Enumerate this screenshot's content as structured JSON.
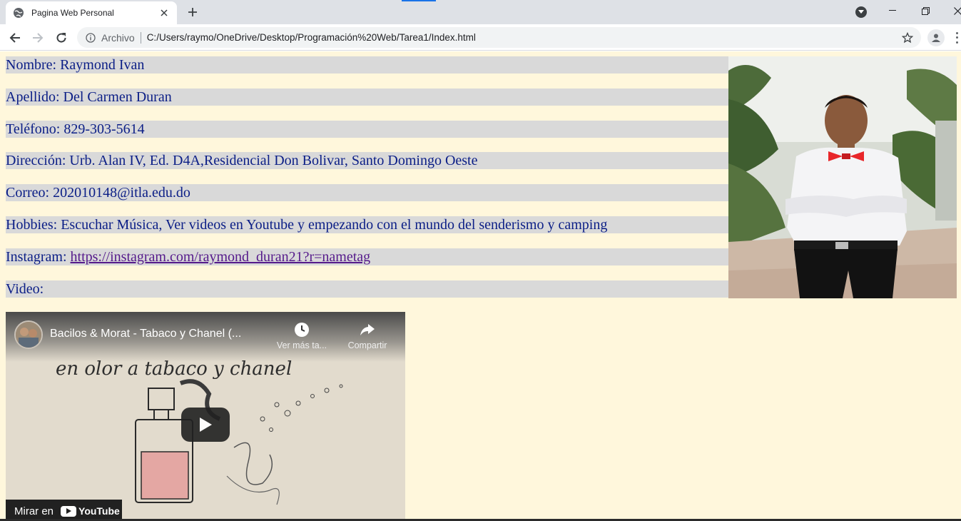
{
  "browser": {
    "tab_title": "Pagina Web Personal",
    "address_scheme_label": "Archivo",
    "url": "C:/Users/raymo/OneDrive/Desktop/Programación%20Web/Tarea1/Index.html"
  },
  "profile": {
    "nombre": "Nombre: Raymond Ivan",
    "apellido": "Apellido: Del Carmen Duran",
    "telefono": "Teléfono: 829-303-5614",
    "direccion": "Dirección: Urb. Alan IV, Ed. D4A,Residencial Don Bolivar, Santo Domingo Oeste",
    "correo": "Correo: 202010148@itla.edu.do",
    "hobbies": "Hobbies: Escuchar Música, Ver videos en Youtube y empezando con el mundo del senderismo y camping",
    "instagram_label": "Instagram: ",
    "instagram_link": "https://instagram.com/raymond_duran21?r=nametag",
    "video_label": "Video:"
  },
  "video": {
    "title": "Bacilos & Morat - Tabaco y Chanel (...",
    "watch_later": "Ver más ta...",
    "share": "Compartir",
    "watch_on": "Mirar en",
    "platform": "YouTube",
    "handwriting": "en olor a tabaco y chanel"
  },
  "colors": {
    "page_bg": "#fff7dc",
    "row_bg": "#d9d9d9",
    "text": "#0b1e86",
    "link": "#551a8b"
  }
}
